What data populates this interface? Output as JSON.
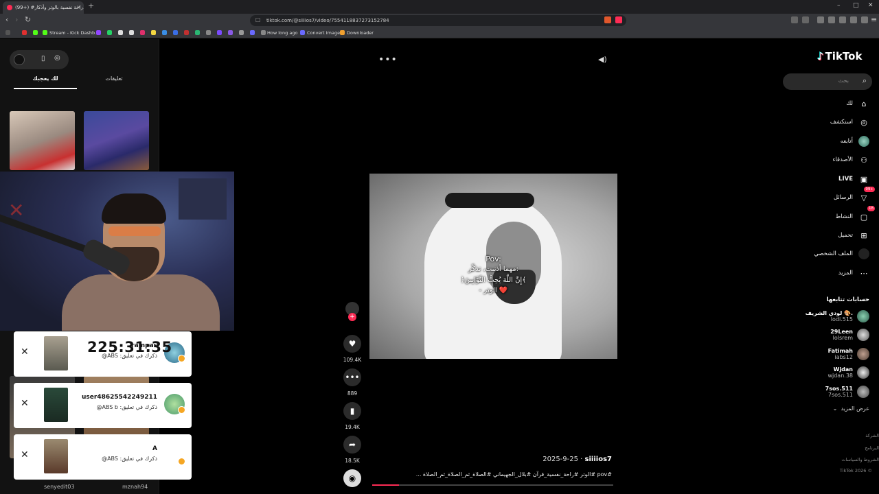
{
  "browser": {
    "tab_title": "(99+) #راحة نفسية بالوتر وأذكار...",
    "tab_close": "×",
    "new_tab": "+",
    "url": "tiktok.com/@siiiios7/video/7554118837273152784",
    "bookmarks": [
      {
        "label": "Stream - Kick Dashb..."
      },
      {
        "label": "How long ago"
      },
      {
        "label": "Convert Image"
      },
      {
        "label": "Downloader"
      }
    ]
  },
  "left_panel": {
    "tabs": {
      "comments": "تعليقات",
      "for_you": "لك يعجبك"
    },
    "bottom_names": [
      "senyedit03",
      "mznah94"
    ]
  },
  "timer": "225:31:35",
  "notifications": [
    {
      "username": "rampas",
      "message": "ذكرك في تعليق: ABS@"
    },
    {
      "username": "user48625542249211",
      "message": "ذكرك في تعليق: ABS b@"
    },
    {
      "username": "A",
      "message": "ذكرك في تعليق: ABS@"
    }
  ],
  "video": {
    "caption_lines": [
      "Pov:",
      "مهما أذنبت، تذكّر:",
      "﴿إِنَّ اللَّهَ يُحِبُّ التَّوَّابِينَ﴾",
      "- الوتر ❤️"
    ],
    "author": "siiiios7",
    "date": "2025-9-25",
    "description": "#pov #الوتر #راحة_نفسية_قرآن #بلال_الجهيماني #الصلاة_ثم_الصلاة_ثم_الصلاة ...",
    "progress": 0.11,
    "menu_glyph": "•••"
  },
  "actions": {
    "likes": "109.4K",
    "comments": "889",
    "saves": "19.4K",
    "shares": "18.5K"
  },
  "sidebar": {
    "logo": "TikTok",
    "search_placeholder": "بحث",
    "nav": [
      {
        "label": "لك",
        "icon": "home-icon"
      },
      {
        "label": "استكشف",
        "icon": "compass-icon"
      },
      {
        "label": "أتابعه",
        "icon": "following-icon"
      },
      {
        "label": "الأصدقاء",
        "icon": "friends-icon"
      },
      {
        "label": "LIVE",
        "icon": "live-icon"
      },
      {
        "label": "الرسائل",
        "icon": "messages-icon",
        "badge": "99+"
      },
      {
        "label": "النشاط",
        "icon": "activity-icon",
        "badge": "18"
      },
      {
        "label": "تحميل",
        "icon": "upload-icon"
      },
      {
        "label": "الملف الشخصي",
        "icon": "profile-icon"
      },
      {
        "label": "المزيد",
        "icon": "more-icon"
      }
    ],
    "following_heading": "حسابات تتابعها",
    "accounts": [
      {
        "name": "لودي الشريف 🎨.",
        "handle": "lodi.515"
      },
      {
        "name": "29Leen",
        "handle": "lolsrem"
      },
      {
        "name": "Fatimah",
        "handle": "iabs12"
      },
      {
        "name": "Wjdan",
        "handle": "wjdan.38"
      },
      {
        "name": "7sos.511",
        "handle": "7sos.511"
      }
    ],
    "see_more": "عرض المزيد",
    "footer": [
      "الشركة",
      "البرنامج",
      "الشروط والسياسات",
      "TikTok 2026 ©"
    ]
  }
}
